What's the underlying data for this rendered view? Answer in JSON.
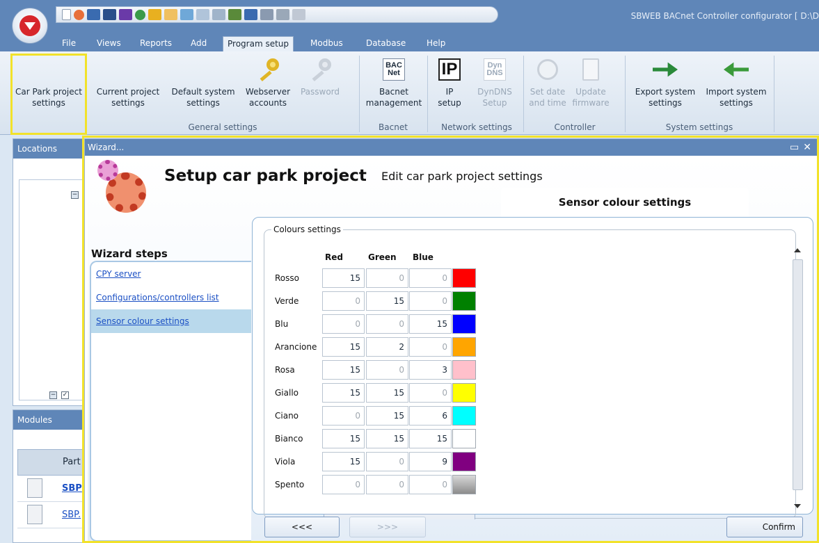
{
  "window": {
    "title": "SBWEB BACnet Controller configurator [ D:\\D"
  },
  "menu": [
    "File",
    "Views",
    "Reports",
    "Add",
    "Program setup",
    "Modbus",
    "Database",
    "Help"
  ],
  "ribbon": {
    "buttons": [
      {
        "line1": "Car Park project",
        "line2": "settings",
        "icon": "gear-red-icon"
      },
      {
        "line1": "Current project",
        "line2": "settings",
        "icon": "gear-blue-icon"
      },
      {
        "line1": "Default system",
        "line2": "settings",
        "icon": "gear-green-icon"
      },
      {
        "line1": "Webserver",
        "line2": "accounts",
        "icon": "key-icon"
      },
      {
        "line1": "Password",
        "line2": "",
        "icon": "key-icon",
        "disabled": true
      },
      {
        "line1": "Bacnet",
        "line2": "management",
        "icon": "bacnet-icon",
        "icon_text": "BAC Net"
      },
      {
        "line1": "IP",
        "line2": "setup",
        "icon": "ip-icon",
        "icon_text": "IP"
      },
      {
        "line1": "DynDNS",
        "line2": "Setup",
        "icon": "dyndns-icon",
        "icon_text": "Dyn DNS",
        "disabled": true
      },
      {
        "line1": "Set date",
        "line2": "and time",
        "icon": "clock-icon",
        "disabled": true
      },
      {
        "line1": "Update",
        "line2": "firmware",
        "icon": "firmware-icon",
        "disabled": true
      },
      {
        "line1": "Export system",
        "line2": "settings",
        "icon": "export-icon"
      },
      {
        "line1": "Import system",
        "line2": "settings",
        "icon": "import-icon"
      }
    ],
    "groups": [
      "General settings",
      "Bacnet",
      "Network settings",
      "Controller",
      "System settings"
    ]
  },
  "locations": {
    "title": "Locations"
  },
  "modules": {
    "title": "Modules",
    "column": "Part",
    "rows": [
      "SBP",
      "SBP."
    ]
  },
  "wizard": {
    "window_title": "Wizard...",
    "title": "Setup car park project",
    "subtitle": "Edit car park project settings",
    "tab": "Sensor colour settings",
    "steps_label": "Wizard steps",
    "steps": [
      "CPY server",
      "Configurations/controllers list",
      "Sensor colour settings"
    ],
    "active_step": 2,
    "group_label": "Colours settings",
    "columns": [
      "Red",
      "Green",
      "Blue"
    ],
    "colours": [
      {
        "name": "Rosso",
        "r": "15",
        "g": "0",
        "b": "0",
        "swatch": "#ff0000"
      },
      {
        "name": "Verde",
        "r": "0",
        "g": "15",
        "b": "0",
        "swatch": "#008000"
      },
      {
        "name": "Blu",
        "r": "0",
        "g": "0",
        "b": "15",
        "swatch": "#0000ff"
      },
      {
        "name": "Arancione",
        "r": "15",
        "g": "2",
        "b": "0",
        "swatch": "#ffa500"
      },
      {
        "name": "Rosa",
        "r": "15",
        "g": "0",
        "b": "3",
        "swatch": "#ffc0cb"
      },
      {
        "name": "Giallo",
        "r": "15",
        "g": "15",
        "b": "0",
        "swatch": "#ffff00"
      },
      {
        "name": "Ciano",
        "r": "0",
        "g": "15",
        "b": "6",
        "swatch": "#00ffff"
      },
      {
        "name": "Bianco",
        "r": "15",
        "g": "15",
        "b": "15",
        "swatch": "#ffffff"
      },
      {
        "name": "Viola",
        "r": "15",
        "g": "0",
        "b": "9",
        "swatch": "#800080"
      },
      {
        "name": "Spento",
        "r": "0",
        "g": "0",
        "b": "0",
        "swatch": "#a0a0a0"
      }
    ],
    "back": "<<<",
    "next": ">>>",
    "confirm": "Confirm"
  },
  "colors": {
    "header_blue": "#5f86b8",
    "highlight_yellow": "#f2e22a",
    "link_blue": "#1a4fc4",
    "active_step_bg": "#b9d9ec"
  }
}
